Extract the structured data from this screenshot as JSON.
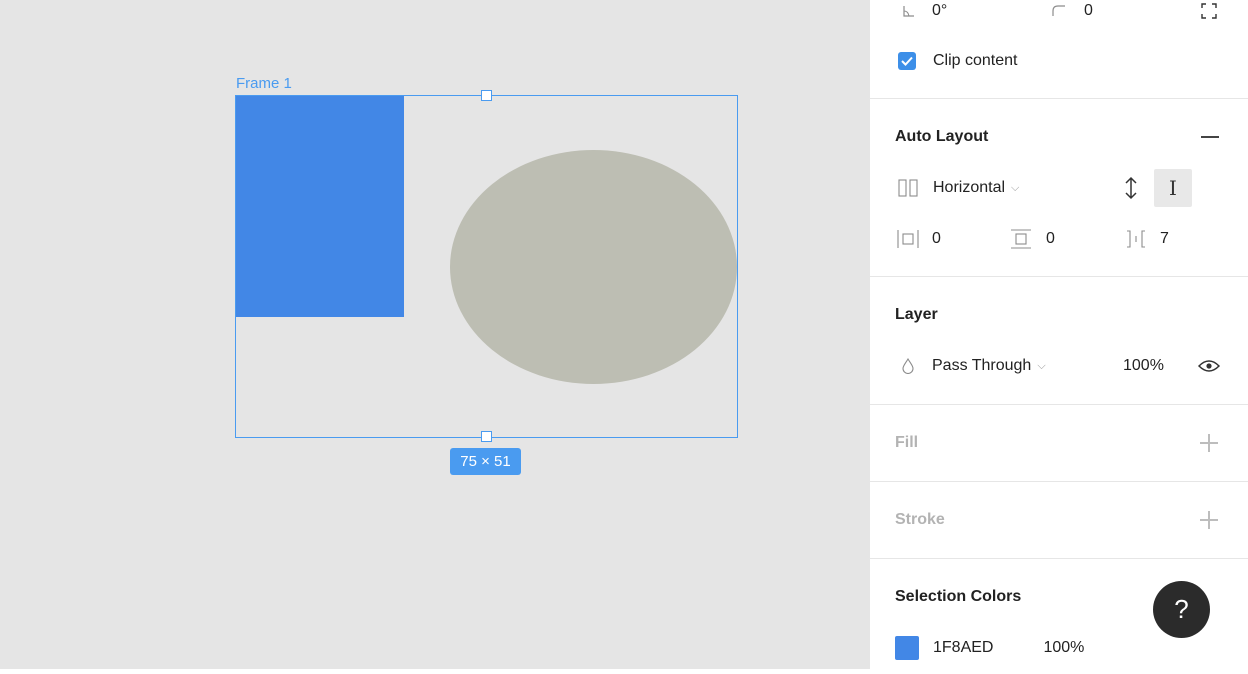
{
  "canvas": {
    "frame_label": "Frame 1",
    "size_badge": "75 × 51",
    "rect_color": "#4287e6",
    "ellipse_color": "#bdbeb3"
  },
  "panel": {
    "rotation": {
      "icon": "angle-icon",
      "value": "0°"
    },
    "corner_radius": {
      "icon": "corner-radius-icon",
      "value": "0"
    },
    "clip_content": {
      "label": "Clip content",
      "checked": true
    },
    "auto_layout": {
      "title": "Auto Layout",
      "direction": "Horizontal",
      "padding_horizontal": "0",
      "padding_vertical": "0",
      "spacing": "7"
    },
    "layer": {
      "title": "Layer",
      "blend_mode": "Pass Through",
      "opacity": "100%"
    },
    "fill": {
      "title": "Fill"
    },
    "stroke": {
      "title": "Stroke"
    },
    "selection_colors": {
      "title": "Selection Colors",
      "items": [
        {
          "hex": "1F8AED",
          "opacity": "100%"
        }
      ]
    }
  },
  "help": {
    "label": "?"
  }
}
